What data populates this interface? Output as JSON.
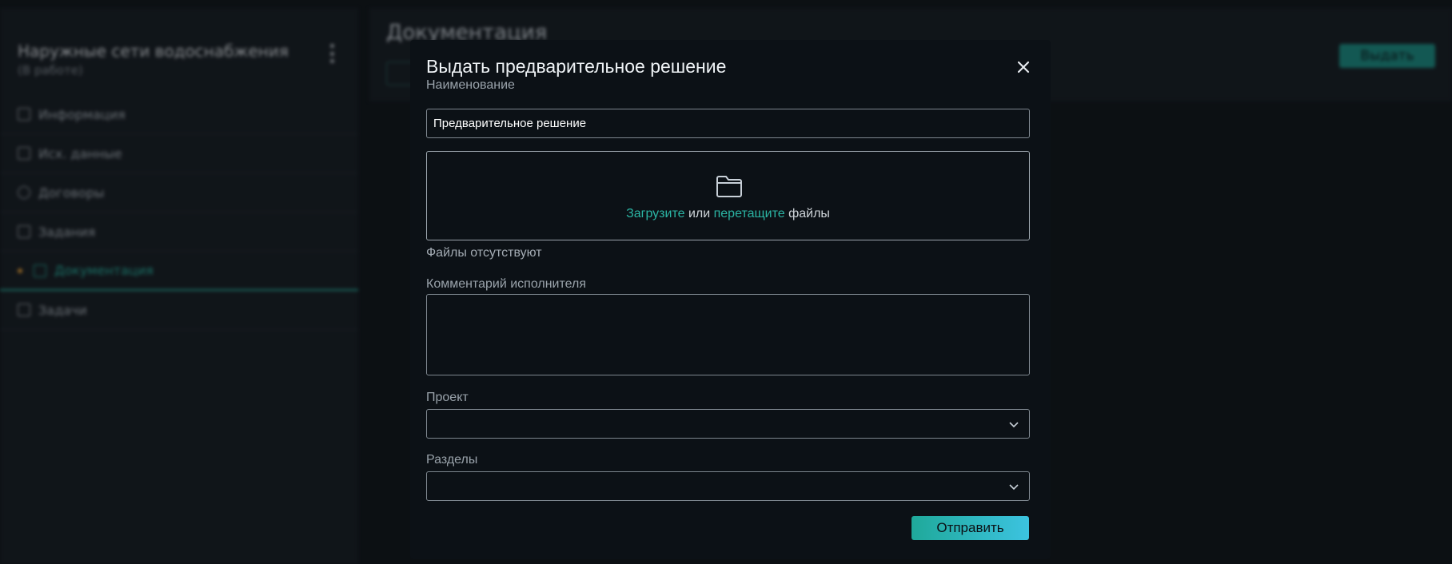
{
  "background": {
    "project": {
      "title": "Наружные сети водоснабжения",
      "status": "(В работе)"
    },
    "nav": [
      {
        "label": "Информация",
        "icon": "info-icon"
      },
      {
        "label": "Исх. данные",
        "icon": "plus-square-icon"
      },
      {
        "label": "Договоры",
        "icon": "pen-icon"
      },
      {
        "label": "Задания",
        "icon": "card-icon"
      },
      {
        "label": "Документация",
        "icon": "document-icon",
        "active": true
      },
      {
        "label": "Задачи",
        "icon": "grid-icon"
      }
    ],
    "main_title": "Документация",
    "issue_button": "Выдать"
  },
  "modal": {
    "title": "Выдать предварительное решение",
    "name_label": "Наименование",
    "name_value": "Предварительное решение",
    "upload": {
      "upload_link": "Загрузите",
      "or": " или ",
      "drag_link": "перетащите",
      "files_word": " файлы"
    },
    "files_status": "Файлы отсутствуют",
    "comment_label": "Комментарий исполнителя",
    "comment_value": "",
    "project_label": "Проект",
    "project_value": "",
    "sections_label": "Разделы",
    "sections_value": "",
    "submit_label": "Отправить"
  },
  "colors": {
    "accent": "#2bb5a4",
    "active_dot": "#e6a23c"
  }
}
